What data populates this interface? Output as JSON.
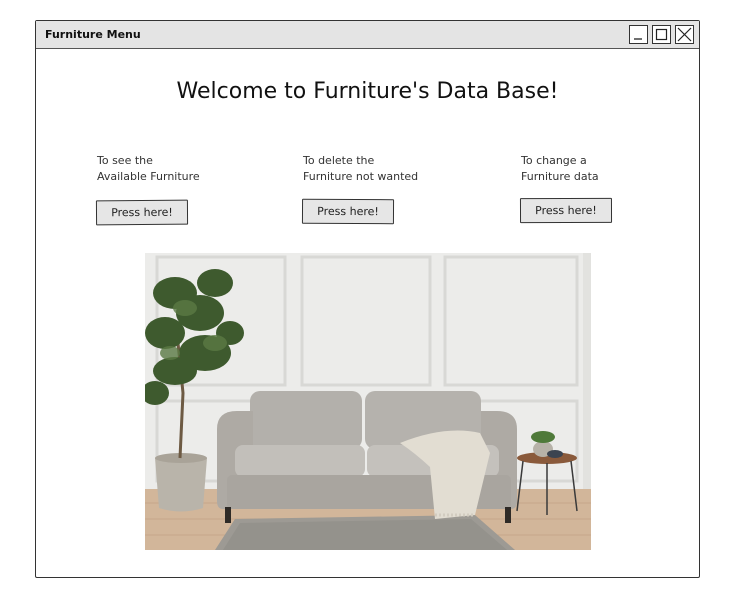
{
  "window": {
    "title": "Furniture Menu",
    "controls": [
      "minimize-icon",
      "maximize-icon",
      "close-icon"
    ]
  },
  "main": {
    "heading": "Welcome to Furniture's Data Base!",
    "actions": [
      {
        "description": "To see the\nAvailable  Furniture",
        "button_label": "Press here!"
      },
      {
        "description": "To delete the\nFurniture not wanted",
        "button_label": "Press here!"
      },
      {
        "description": "To change a\nFurniture data",
        "button_label": "Press here!"
      }
    ],
    "image": "living-room-sofa-photo"
  }
}
